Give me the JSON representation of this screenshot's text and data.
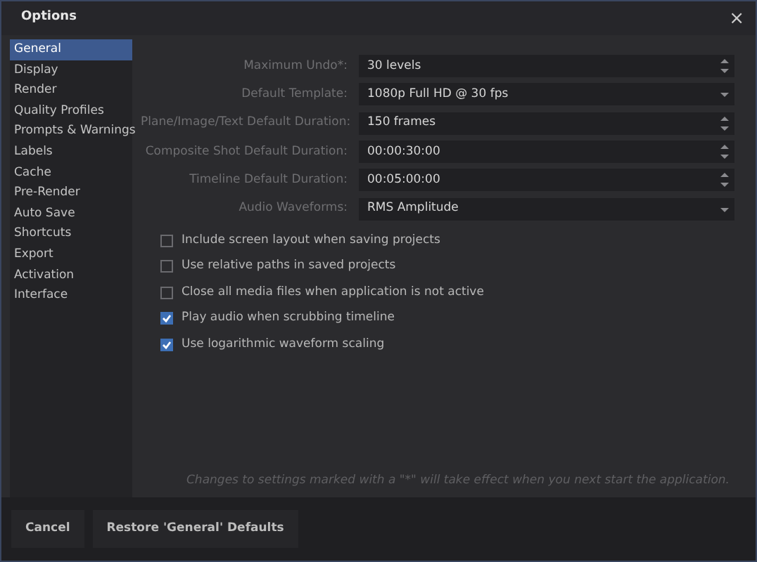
{
  "window": {
    "title": "Options",
    "close": "×"
  },
  "sidebar": {
    "items": [
      {
        "label": "General",
        "selected": true
      },
      {
        "label": "Display",
        "selected": false
      },
      {
        "label": "Render",
        "selected": false
      },
      {
        "label": "Quality Profiles",
        "selected": false
      },
      {
        "label": "Prompts & Warnings",
        "selected": false
      },
      {
        "label": "Labels",
        "selected": false
      },
      {
        "label": "Cache",
        "selected": false
      },
      {
        "label": "Pre-Render",
        "selected": false
      },
      {
        "label": "Auto Save",
        "selected": false
      },
      {
        "label": "Shortcuts",
        "selected": false
      },
      {
        "label": "Export",
        "selected": false
      },
      {
        "label": "Activation",
        "selected": false
      },
      {
        "label": "Interface",
        "selected": false
      }
    ]
  },
  "fields": [
    {
      "label": "Maximum Undo*:",
      "value": "30 levels",
      "kind": "spin"
    },
    {
      "label": "Default Template:",
      "value": "1080p Full HD @ 30 fps",
      "kind": "dropdown"
    },
    {
      "label": "Plane/Image/Text Default Duration:",
      "value": "150 frames",
      "kind": "spin"
    },
    {
      "label": "Composite Shot Default Duration:",
      "value": "00:00:30:00",
      "kind": "spin"
    },
    {
      "label": "Timeline Default Duration:",
      "value": "00:05:00:00",
      "kind": "spin"
    },
    {
      "label": "Audio Waveforms:",
      "value": "RMS Amplitude",
      "kind": "dropdown"
    }
  ],
  "checkboxes": [
    {
      "label": "Include screen layout when saving projects",
      "checked": false
    },
    {
      "label": "Use relative paths in saved projects",
      "checked": false
    },
    {
      "label": "Close all media files when application is not active",
      "checked": false
    },
    {
      "label": "Play audio when scrubbing timeline",
      "checked": true
    },
    {
      "label": "Use logarithmic waveform scaling",
      "checked": true
    }
  ],
  "note": "Changes to settings marked with a \"*\" will take effect when you next start the application.",
  "buttons": [
    "Cancel",
    "Restore 'General' Defaults"
  ]
}
